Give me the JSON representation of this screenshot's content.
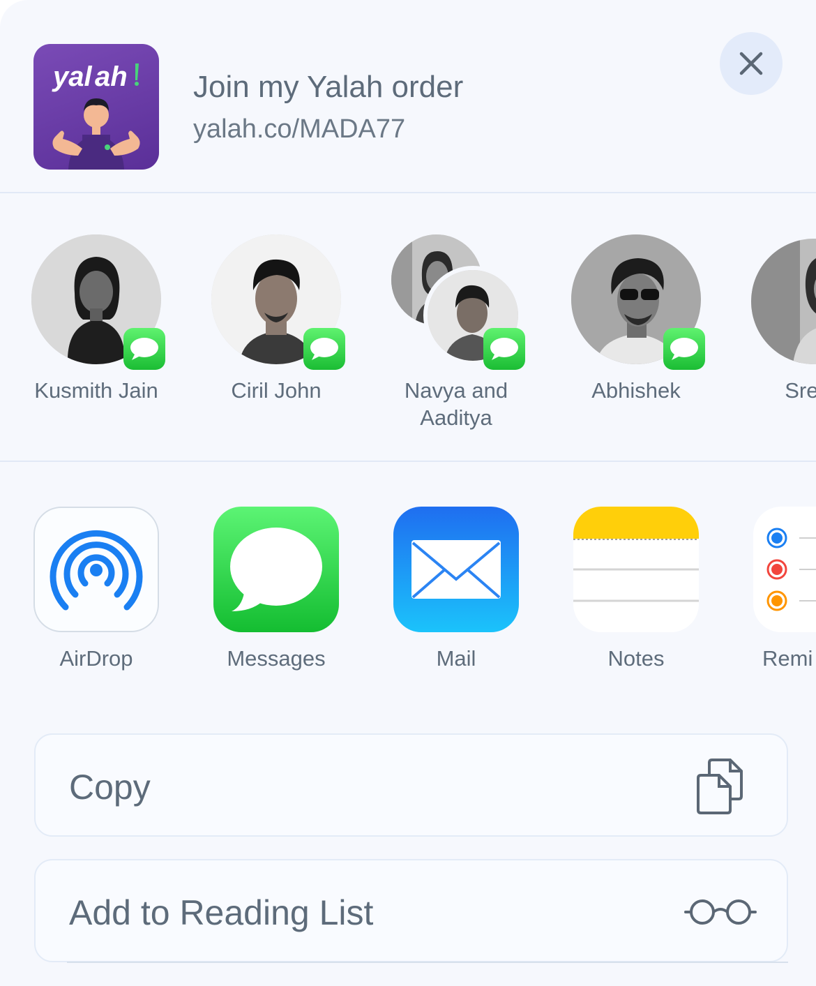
{
  "header": {
    "thumbnail_text": "yalah!",
    "title": "Join my Yalah order",
    "url": "yalah.co/MADA77",
    "close_icon": "close-icon"
  },
  "people": [
    {
      "name": "Kusmith Jain",
      "badge": "messages-badge-icon"
    },
    {
      "name": "Ciril John",
      "badge": "messages-badge-icon"
    },
    {
      "name_line1": "Navya and",
      "name_line2": "Aaditya",
      "badge": "messages-badge-icon"
    },
    {
      "name": "Abhishek",
      "badge": "messages-badge-icon"
    },
    {
      "name": "Sreela"
    }
  ],
  "apps": [
    {
      "label": "AirDrop",
      "icon": "airdrop-icon"
    },
    {
      "label": "Messages",
      "icon": "messages-icon"
    },
    {
      "label": "Mail",
      "icon": "mail-icon"
    },
    {
      "label": "Notes",
      "icon": "notes-icon"
    },
    {
      "label": "Remi",
      "icon": "reminders-icon"
    }
  ],
  "actions": [
    {
      "label": "Copy",
      "icon": "copy-icon"
    },
    {
      "label": "Add to Reading List",
      "icon": "glasses-icon"
    }
  ],
  "colors": {
    "sheet_bg": "#f6f8fd",
    "text": "#5d6b7a",
    "messages_green": "#1bbd34",
    "mail_blue": "#1e6ff0",
    "notes_yellow": "#ffcf0a"
  }
}
